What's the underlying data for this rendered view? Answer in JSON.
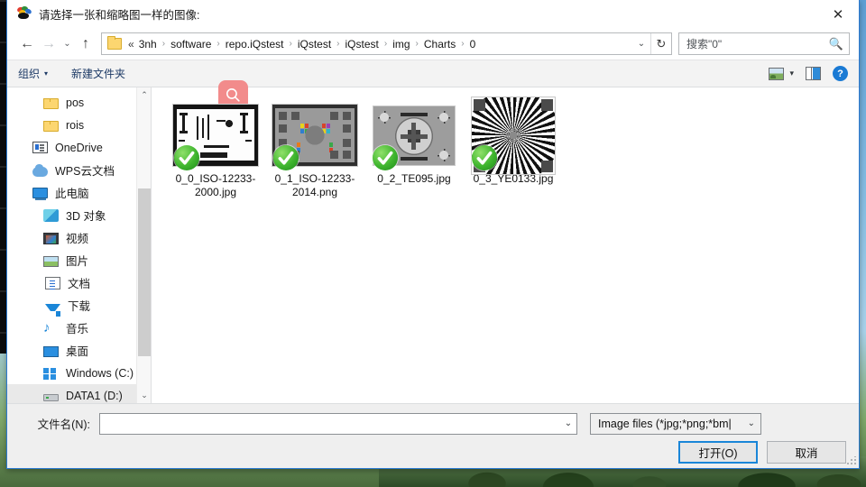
{
  "window": {
    "title": "请选择一张和缩略图一样的图像:",
    "app_icon": "palette-icon",
    "close_label": "✕"
  },
  "nav": {
    "back_icon": "←",
    "forward_icon": "→",
    "recent_icon": "⌄",
    "up_icon": "↑",
    "refresh_icon": "↻",
    "dropdown_icon": "⌄",
    "breadcrumb_lead": "«",
    "breadcrumb": [
      "3nh",
      "software",
      "repo.iQstest",
      "iQstest",
      "iQstest",
      "img",
      "Charts",
      "0"
    ],
    "separator": "›"
  },
  "search": {
    "placeholder": "搜索\"0\"",
    "value": "",
    "icon": "search-icon"
  },
  "toolbar": {
    "organize_label": "组织",
    "organize_caret": "▾",
    "new_folder_label": "新建文件夹",
    "view_icon": "view-options-icon",
    "view_caret": "▾",
    "preview_pane_icon": "preview-pane-icon",
    "help_icon": "?"
  },
  "sidebar": {
    "items": [
      {
        "label": "pos",
        "icon": "folder-icon",
        "indent": 1,
        "hover": false
      },
      {
        "label": "rois",
        "icon": "folder-icon",
        "indent": 1,
        "hover": false
      },
      {
        "label": "OneDrive",
        "icon": "onedrive-icon",
        "indent": 0,
        "hover": false
      },
      {
        "label": "WPS云文档",
        "icon": "cloud-icon",
        "indent": 0,
        "hover": false
      },
      {
        "label": "此电脑",
        "icon": "pc-icon",
        "indent": 0,
        "hover": false
      },
      {
        "label": "3D 对象",
        "icon": "3d-object-icon",
        "indent": 1,
        "hover": false
      },
      {
        "label": "视频",
        "icon": "video-icon",
        "indent": 1,
        "hover": false
      },
      {
        "label": "图片",
        "icon": "pictures-icon",
        "indent": 1,
        "hover": false
      },
      {
        "label": "文档",
        "icon": "documents-icon",
        "indent": 1,
        "hover": false
      },
      {
        "label": "下载",
        "icon": "download-icon",
        "indent": 1,
        "hover": false
      },
      {
        "label": "音乐",
        "icon": "music-icon",
        "indent": 1,
        "hover": false
      },
      {
        "label": "桌面",
        "icon": "desktop-icon",
        "indent": 1,
        "hover": false
      },
      {
        "label": "Windows (C:)",
        "icon": "windows-drive-icon",
        "indent": 1,
        "hover": false
      },
      {
        "label": "DATA1 (D:)",
        "icon": "drive-icon",
        "indent": 1,
        "hover": true
      }
    ],
    "scroll_up_icon": "⌃",
    "scroll_down_icon": "⌄"
  },
  "files": [
    {
      "name": "0_0_ISO-12233-2000.jpg",
      "thumb": "iso12233-2000-chart",
      "badge": "green-check"
    },
    {
      "name": "0_1_ISO-12233-2014.png",
      "thumb": "iso12233-2014-chart",
      "badge": "green-check"
    },
    {
      "name": "0_2_TE095.jpg",
      "thumb": "te095-chart",
      "badge": "green-check"
    },
    {
      "name": "0_3_YE0133.jpg",
      "thumb": "ye0133-siemens-star",
      "badge": "green-check"
    }
  ],
  "overlay": {
    "magnifier_icon": "magnifier-icon",
    "color": "#f28b8b"
  },
  "bottom": {
    "filename_label": "文件名(N):",
    "filename_value": "",
    "filename_caret": "⌄",
    "filter_text": "Image files  (*jpg;*png;*bm|",
    "filter_caret": "⌄",
    "open_button": "打开(O)",
    "cancel_button": "取消"
  },
  "colors": {
    "accent": "#1a86d8",
    "window_border": "#2a7ad2",
    "toolbar_bg": "#f3f3f3",
    "bottom_bg": "#efefef",
    "badge_green": "#3fb52e",
    "overlay_pink": "#f28b8b"
  }
}
